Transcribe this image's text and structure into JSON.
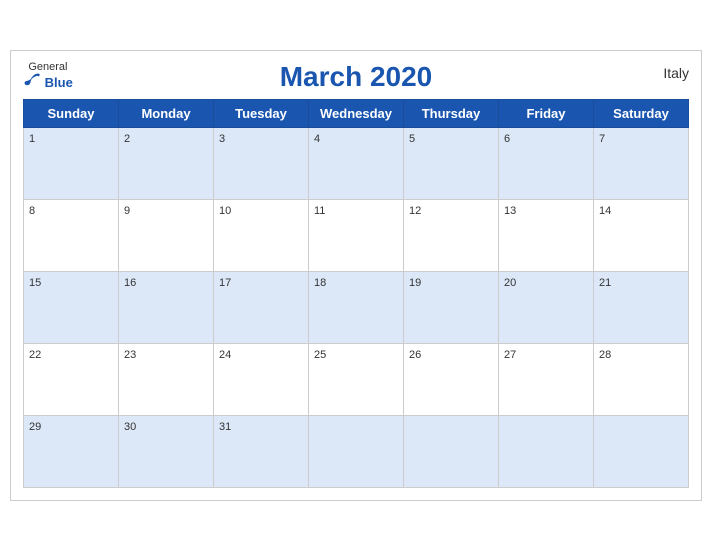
{
  "header": {
    "logo_general": "General",
    "logo_blue": "Blue",
    "title": "March 2020",
    "country": "Italy"
  },
  "weekdays": [
    "Sunday",
    "Monday",
    "Tuesday",
    "Wednesday",
    "Thursday",
    "Friday",
    "Saturday"
  ],
  "weeks": [
    [
      {
        "num": "1",
        "empty": false
      },
      {
        "num": "2",
        "empty": false
      },
      {
        "num": "3",
        "empty": false
      },
      {
        "num": "4",
        "empty": false
      },
      {
        "num": "5",
        "empty": false
      },
      {
        "num": "6",
        "empty": false
      },
      {
        "num": "7",
        "empty": false
      }
    ],
    [
      {
        "num": "8",
        "empty": false
      },
      {
        "num": "9",
        "empty": false
      },
      {
        "num": "10",
        "empty": false
      },
      {
        "num": "11",
        "empty": false
      },
      {
        "num": "12",
        "empty": false
      },
      {
        "num": "13",
        "empty": false
      },
      {
        "num": "14",
        "empty": false
      }
    ],
    [
      {
        "num": "15",
        "empty": false
      },
      {
        "num": "16",
        "empty": false
      },
      {
        "num": "17",
        "empty": false
      },
      {
        "num": "18",
        "empty": false
      },
      {
        "num": "19",
        "empty": false
      },
      {
        "num": "20",
        "empty": false
      },
      {
        "num": "21",
        "empty": false
      }
    ],
    [
      {
        "num": "22",
        "empty": false
      },
      {
        "num": "23",
        "empty": false
      },
      {
        "num": "24",
        "empty": false
      },
      {
        "num": "25",
        "empty": false
      },
      {
        "num": "26",
        "empty": false
      },
      {
        "num": "27",
        "empty": false
      },
      {
        "num": "28",
        "empty": false
      }
    ],
    [
      {
        "num": "29",
        "empty": false
      },
      {
        "num": "30",
        "empty": false
      },
      {
        "num": "31",
        "empty": false
      },
      {
        "num": "",
        "empty": true
      },
      {
        "num": "",
        "empty": true
      },
      {
        "num": "",
        "empty": true
      },
      {
        "num": "",
        "empty": true
      }
    ]
  ]
}
